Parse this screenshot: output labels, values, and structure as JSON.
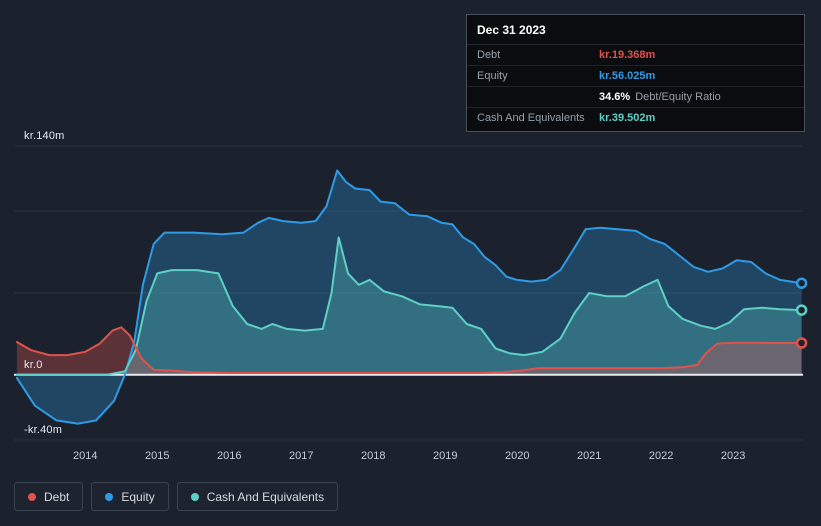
{
  "colors": {
    "background": "#1b222d",
    "debt": "#e0534d",
    "equity": "#2e9be6",
    "cash": "#5ed0c5",
    "zero_line": "#e8ecf1",
    "gridline": "#2a3240"
  },
  "tooltip": {
    "date": "Dec 31 2023",
    "debt": {
      "label": "Debt",
      "value": "kr.19.368m",
      "color": "#e0534d"
    },
    "equity": {
      "label": "Equity",
      "value": "kr.56.025m",
      "color": "#2e9be6"
    },
    "ratio": {
      "value": "34.6%",
      "label": "Debt/Equity Ratio"
    },
    "cash": {
      "label": "Cash And Equivalents",
      "value": "kr.39.502m",
      "color": "#5ed0c5"
    }
  },
  "legend": {
    "items": [
      {
        "id": "debt",
        "label": "Debt",
        "color": "#e0534d"
      },
      {
        "id": "equity",
        "label": "Equity",
        "color": "#2e9be6"
      },
      {
        "id": "cash",
        "label": "Cash And Equivalents",
        "color": "#5ed0c5"
      }
    ]
  },
  "chart_data": {
    "type": "area",
    "x_ticks": [
      2014,
      2015,
      2016,
      2017,
      2018,
      2019,
      2020,
      2021,
      2022,
      2023
    ],
    "axis": {
      "x_min": 2013.01,
      "x_max": 2023.97,
      "y_min": -40,
      "y_max": 140,
      "y_ticks": [
        {
          "value": 140,
          "label": "kr.140m"
        },
        {
          "value": 0,
          "label": "kr.0"
        },
        {
          "value": -40,
          "label": "-kr.40m"
        }
      ],
      "gridlines": [
        140,
        100,
        50,
        -40
      ],
      "zero_line": 0
    },
    "series": [
      {
        "id": "equity",
        "name": "Equity",
        "color": "#2e9be6",
        "fill": "rgba(46,155,230,0.30)",
        "x": [
          2013.05,
          2013.3,
          2013.6,
          2013.9,
          2014.15,
          2014.4,
          2014.55,
          2014.68,
          2014.8,
          2014.95,
          2015.1,
          2015.5,
          2015.9,
          2016.2,
          2016.4,
          2016.55,
          2016.75,
          2017.0,
          2017.2,
          2017.35,
          2017.5,
          2017.62,
          2017.75,
          2017.95,
          2018.1,
          2018.3,
          2018.5,
          2018.75,
          2018.95,
          2019.1,
          2019.25,
          2019.4,
          2019.55,
          2019.7,
          2019.85,
          2020.0,
          2020.2,
          2020.4,
          2020.6,
          2020.8,
          2020.95,
          2021.15,
          2021.4,
          2021.65,
          2021.85,
          2022.05,
          2022.25,
          2022.45,
          2022.65,
          2022.85,
          2023.05,
          2023.25,
          2023.45,
          2023.65,
          2023.95
        ],
        "values": [
          -2,
          -19,
          -28,
          -30,
          -28,
          -16,
          0,
          20,
          55,
          80,
          87,
          87,
          86,
          87,
          93,
          96,
          94,
          93,
          94,
          103,
          125,
          118,
          114,
          113,
          106,
          105,
          98,
          97,
          93,
          92,
          84,
          80,
          72,
          67,
          60,
          58,
          57,
          58,
          64,
          78,
          89,
          90,
          89,
          88,
          83,
          80,
          73,
          66,
          63,
          65,
          70,
          69,
          62,
          58,
          56.025
        ]
      },
      {
        "id": "cash",
        "name": "Cash And Equivalents",
        "color": "#5ed0c5",
        "fill": "rgba(94,208,197,0.30)",
        "x": [
          2013.05,
          2014.3,
          2014.55,
          2014.7,
          2014.85,
          2015.0,
          2015.2,
          2015.55,
          2015.85,
          2016.05,
          2016.25,
          2016.45,
          2016.6,
          2016.8,
          2017.05,
          2017.3,
          2017.42,
          2017.52,
          2017.65,
          2017.8,
          2017.95,
          2018.15,
          2018.4,
          2018.65,
          2018.9,
          2019.1,
          2019.3,
          2019.5,
          2019.7,
          2019.9,
          2020.1,
          2020.35,
          2020.6,
          2020.8,
          2021.0,
          2021.25,
          2021.5,
          2021.75,
          2021.95,
          2022.1,
          2022.3,
          2022.55,
          2022.75,
          2022.95,
          2023.15,
          2023.4,
          2023.65,
          2023.95
        ],
        "values": [
          0,
          0,
          2,
          15,
          45,
          62,
          64,
          64,
          62,
          42,
          31,
          28,
          31,
          28,
          27,
          28,
          50,
          84,
          62,
          55,
          58,
          51,
          48,
          43,
          42,
          41,
          31,
          28,
          16,
          13,
          12,
          14,
          22,
          38,
          50,
          48,
          48,
          54,
          58,
          42,
          34,
          30,
          28,
          32,
          40,
          41,
          40,
          39.502
        ]
      },
      {
        "id": "debt",
        "name": "Debt",
        "color": "#e0534d",
        "fill": "rgba(224,83,77,0.32)",
        "x": [
          2013.05,
          2013.25,
          2013.5,
          2013.75,
          2014.0,
          2014.2,
          2014.38,
          2014.5,
          2014.62,
          2014.78,
          2014.95,
          2015.2,
          2015.5,
          2016.0,
          2016.5,
          2017.0,
          2017.5,
          2018.0,
          2018.5,
          2019.0,
          2019.5,
          2019.8,
          2020.05,
          2020.3,
          2020.6,
          2021.0,
          2021.5,
          2022.0,
          2022.3,
          2022.5,
          2022.62,
          2022.78,
          2023.0,
          2023.3,
          2023.6,
          2023.95
        ],
        "values": [
          20,
          15,
          12,
          12,
          14,
          19,
          27,
          29,
          24,
          10,
          3,
          2.5,
          1.5,
          1,
          1,
          1,
          1,
          1,
          1,
          1,
          1,
          1.5,
          2.5,
          4,
          4,
          4,
          4,
          4,
          4.5,
          6,
          13,
          19,
          19.5,
          19.5,
          19.4,
          19.368
        ]
      }
    ]
  }
}
